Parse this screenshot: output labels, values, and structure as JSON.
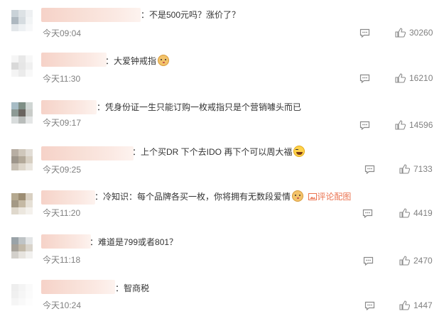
{
  "comments": [
    {
      "text": "：不是500元吗？涨价了？",
      "time": "今天09:04",
      "likes": "30260"
    },
    {
      "text": "：大爱钟戒指",
      "time": "今天11:30",
      "likes": "16210",
      "emoji": "doge-emoji"
    },
    {
      "text": "：凭身份证一生只能订购一枚戒指只是个营销噱头而已",
      "time": "今天09:17",
      "likes": "14596"
    },
    {
      "text": "：上个买DR 下个去IDO 再下个可以周大福",
      "time": "今天09:25",
      "likes": "7133",
      "emoji": "laugh-cry-emoji"
    },
    {
      "text": "：冷知识：每个品牌各买一枚，你将拥有无数段爱情",
      "time": "今天11:20",
      "likes": "4419",
      "emoji": "doge-emoji",
      "link": "评论配图"
    },
    {
      "text": "：难道是799或者801？",
      "time": "今天11:18",
      "likes": "2470"
    },
    {
      "text": "：智商税",
      "time": "今天10:24",
      "likes": "1447"
    }
  ],
  "colors": {
    "link": "#eb7350",
    "meta": "#808080",
    "text": "#333333"
  },
  "icons": {
    "reply": "comment-icon",
    "like": "thumbs-up-icon",
    "picture": "image-icon"
  }
}
